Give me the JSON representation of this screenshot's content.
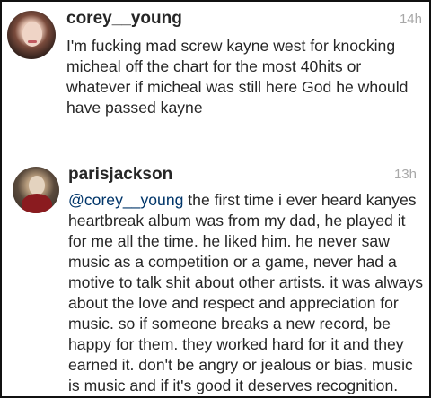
{
  "comments": [
    {
      "username": "corey__young",
      "time": "14h",
      "text": "I'm fucking mad screw kayne west for knocking micheal off the chart for the most 40hits or whatever if micheal was still here God he whould have passed kayne"
    },
    {
      "username": "parisjackson",
      "time": "13h",
      "mention": "@corey__young",
      "text": " the first time i ever heard kanyes heartbreak album was from my dad, he played it for me all the time. he liked him. he never saw music as a competition or a game, never had a motive to talk shit about other artists. it was always about the love and respect and appreciation for music. so if someone breaks a new record, be happy for them. they worked hard for it and they earned it. don't be angry or jealous or bias. music is music and if it's good it deserves recognition."
    }
  ],
  "colors": {
    "username": "#262626",
    "timestamp": "#a8a8a8",
    "mention": "#003569"
  },
  "icons": {
    "comment_1_avatar": "user-avatar-photo",
    "comment_2_avatar": "user-avatar-photo"
  }
}
